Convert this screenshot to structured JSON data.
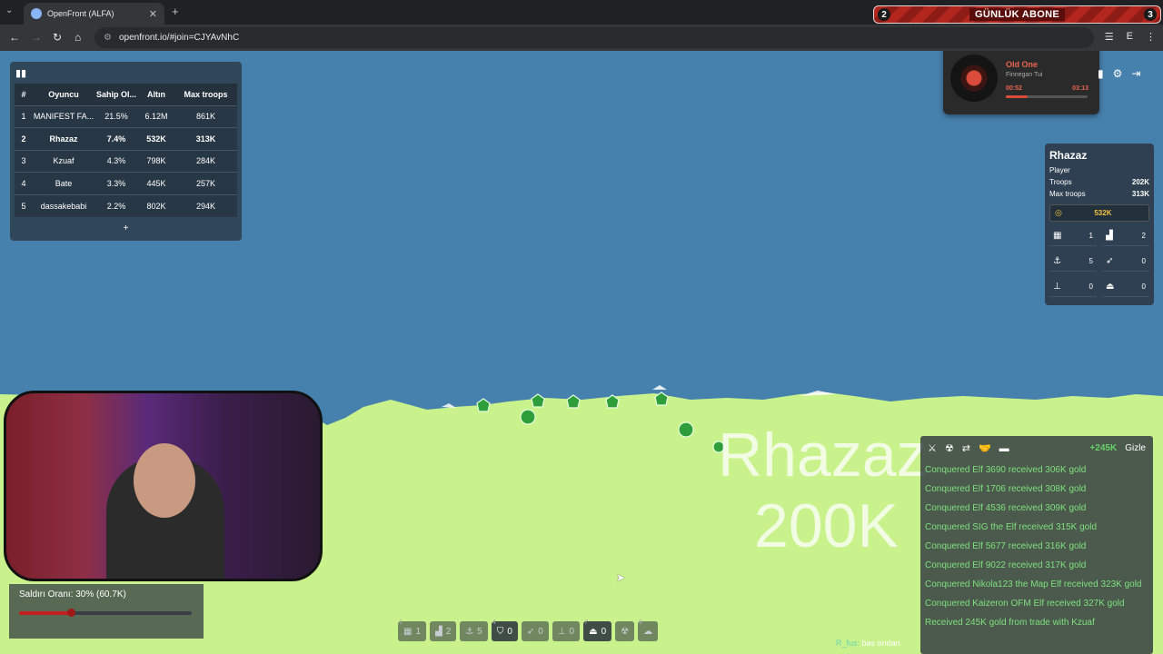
{
  "browser": {
    "tab_title": "OpenFront (ALFA)",
    "url": "openfront.io/#join=CJYAvNhC",
    "banner": {
      "left_count": "2",
      "text": "GÜNLÜK ABONE",
      "right_count": "3"
    }
  },
  "leaderboard": {
    "headers": [
      "#",
      "Oyuncu",
      "Sahip Ol...",
      "Altın",
      "Max troops"
    ],
    "rows": [
      [
        "1",
        "MANIFEST FA...",
        "21.5%",
        "6.12M",
        "861K"
      ],
      [
        "2",
        "Rhazaz",
        "7.4%",
        "532K",
        "313K"
      ],
      [
        "3",
        "Kzuaf",
        "4.3%",
        "798K",
        "284K"
      ],
      [
        "4",
        "Bate",
        "3.3%",
        "445K",
        "257K"
      ],
      [
        "5",
        "dassakebabi",
        "2.2%",
        "802K",
        "294K"
      ]
    ],
    "more_label": "+"
  },
  "music": {
    "song": "Old One",
    "artist": "Finnegan Tui",
    "elapsed": "00:52",
    "total": "03:13",
    "progress": 0.27
  },
  "player": {
    "name": "Rhazaz",
    "type": "Player",
    "troops_label": "Troops",
    "troops": "202K",
    "max_label": "Max troops",
    "max": "313K",
    "gold": "532K",
    "buildings": [
      {
        "icon": "city-icon",
        "count": "1"
      },
      {
        "icon": "factory-icon",
        "count": "2"
      },
      {
        "icon": "port-icon",
        "count": "5"
      },
      {
        "icon": "missile-silo-icon",
        "count": "0"
      },
      {
        "icon": "sam-launcher-icon",
        "count": "0"
      },
      {
        "icon": "warship-icon",
        "count": "0"
      }
    ]
  },
  "map": {
    "territory_name": "Rhazaz",
    "territory_troops": "200K",
    "land_color": "#c9f28c",
    "water_color": "#4680ad"
  },
  "attack": {
    "label": "Saldırı Oranı: 30% (60.7K)",
    "ratio": 0.3
  },
  "events": {
    "gain": "+245K",
    "hide_label": "Gizle",
    "items": [
      "Conquered Elf 3690 received 306K gold",
      "Conquered Elf 1706 received 308K gold",
      "Conquered Elf 4536 received 309K gold",
      "Conquered SIG the Elf received 315K gold",
      "Conquered Elf 5677 received 316K gold",
      "Conquered Elf 9022 received 317K gold",
      "Conquered Nikola123 the Map Elf received 323K gold",
      "Conquered Kaizeron OFM Elf received 327K gold",
      "Received 245K gold from trade with Kzuaf"
    ]
  },
  "toolbar": [
    {
      "key": "1",
      "icon": "city-icon",
      "count": "1"
    },
    {
      "key": "",
      "icon": "factory-icon",
      "count": "2"
    },
    {
      "key": "",
      "icon": "port-icon",
      "count": "5"
    },
    {
      "key": "4",
      "icon": "defense-post-icon",
      "count": "0"
    },
    {
      "key": "",
      "icon": "missile-silo-icon",
      "count": "0"
    },
    {
      "key": "",
      "icon": "sam-launcher-icon",
      "count": "0"
    },
    {
      "key": "7",
      "icon": "warship-icon",
      "count": "0"
    },
    {
      "key": "",
      "icon": "atom-bomb-icon",
      "count": ""
    },
    {
      "key": "9",
      "icon": "hydrogen-bomb-icon",
      "count": ""
    }
  ],
  "chat": {
    "user": "R_fus:",
    "message": "bas ondan"
  }
}
